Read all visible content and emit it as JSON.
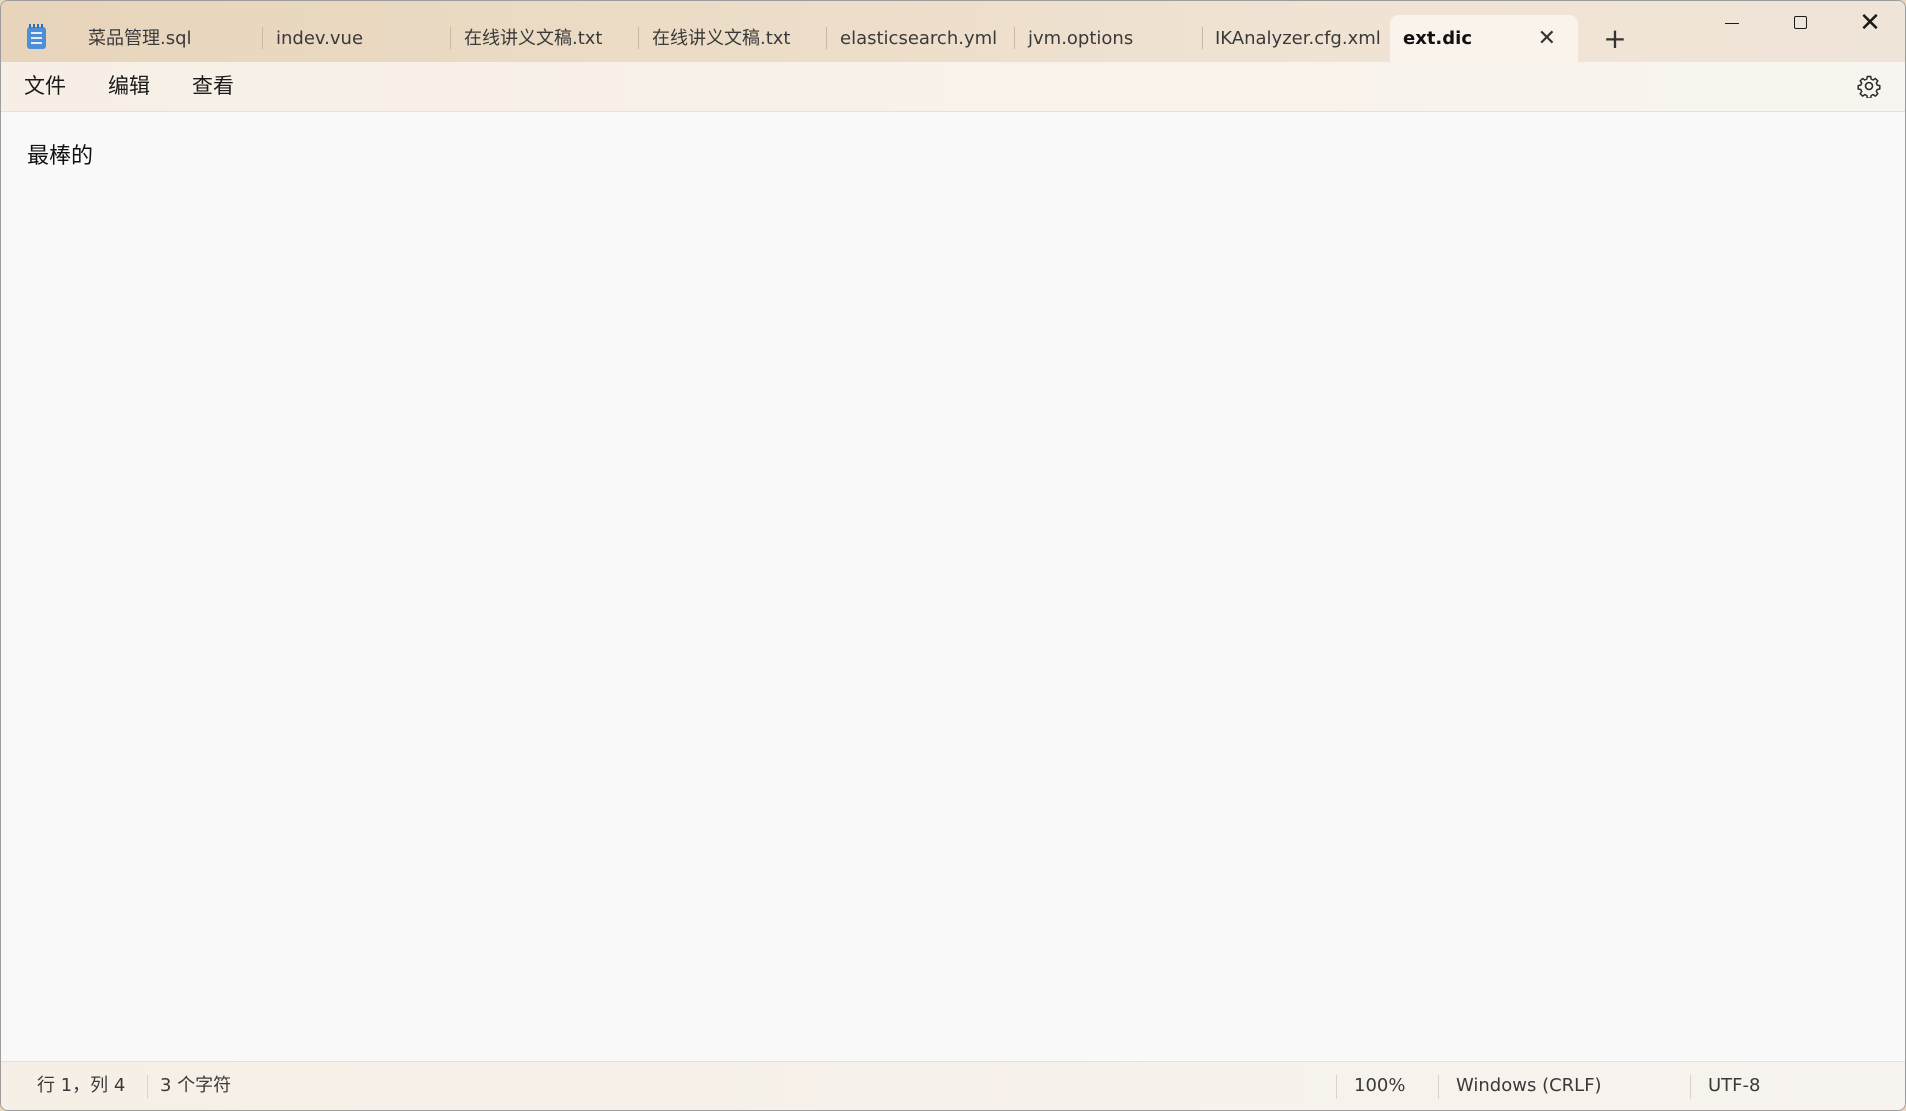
{
  "tabs": [
    {
      "label": "菜品管理.sql",
      "active": false
    },
    {
      "label": "indev.vue",
      "active": false
    },
    {
      "label": "在线讲义文稿.txt",
      "active": false
    },
    {
      "label": "在线讲义文稿.txt",
      "active": false
    },
    {
      "label": "elasticsearch.yml",
      "active": false
    },
    {
      "label": "jvm.options",
      "active": false
    },
    {
      "label": "IKAnalyzer.cfg.xml",
      "active": false
    },
    {
      "label": "ext.dic",
      "active": true
    }
  ],
  "tab_close_glyph": "✕",
  "new_tab_glyph": "+",
  "window_controls": {
    "close_glyph": "✕"
  },
  "menu": {
    "file": "文件",
    "edit": "编辑",
    "view": "查看"
  },
  "icons": {
    "app": "notepad-icon",
    "settings": "gear-icon"
  },
  "editor": {
    "content": "最棒的"
  },
  "status": {
    "position": "行 1，列 4",
    "char_count": "3 个字符",
    "zoom": "100%",
    "line_ending": "Windows (CRLF)",
    "encoding": "UTF-8"
  }
}
